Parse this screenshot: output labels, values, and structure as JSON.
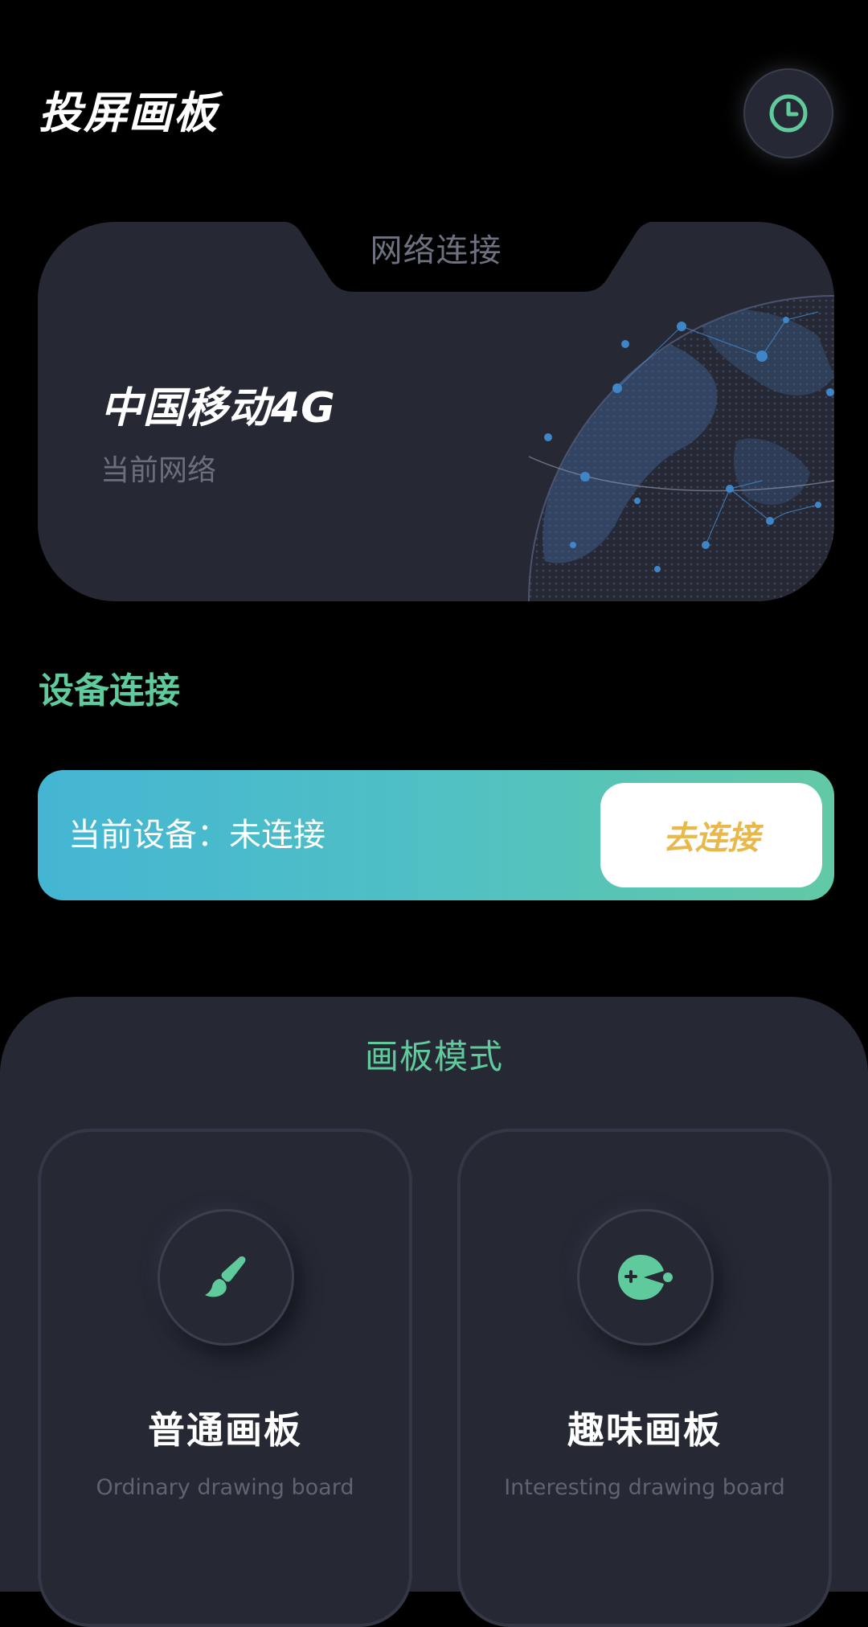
{
  "header": {
    "title": "投屏画板",
    "history_icon": "clock-icon"
  },
  "network": {
    "label": "网络连接",
    "carrier": "中国移动4G",
    "subtitle": "当前网络",
    "illustration": "globe-map-image"
  },
  "device": {
    "section_title": "设备连接",
    "status_text": "当前设备：未连接",
    "connect_label": "去连接"
  },
  "board": {
    "title": "画板模式",
    "modes": [
      {
        "name": "普通画板",
        "subtitle": "Ordinary drawing board",
        "icon": "paintbrush-icon"
      },
      {
        "name": "趣味画板",
        "subtitle": "Interesting drawing board",
        "icon": "pacman-icon"
      }
    ]
  },
  "colors": {
    "background": "#000000",
    "card": "#262834",
    "accent_green": "#5fcb9c",
    "gradient_start": "#44b6d3",
    "gradient_end": "#62c9a6",
    "connect_text": "#e9b84a",
    "globe_dots": "#3f86c9"
  }
}
